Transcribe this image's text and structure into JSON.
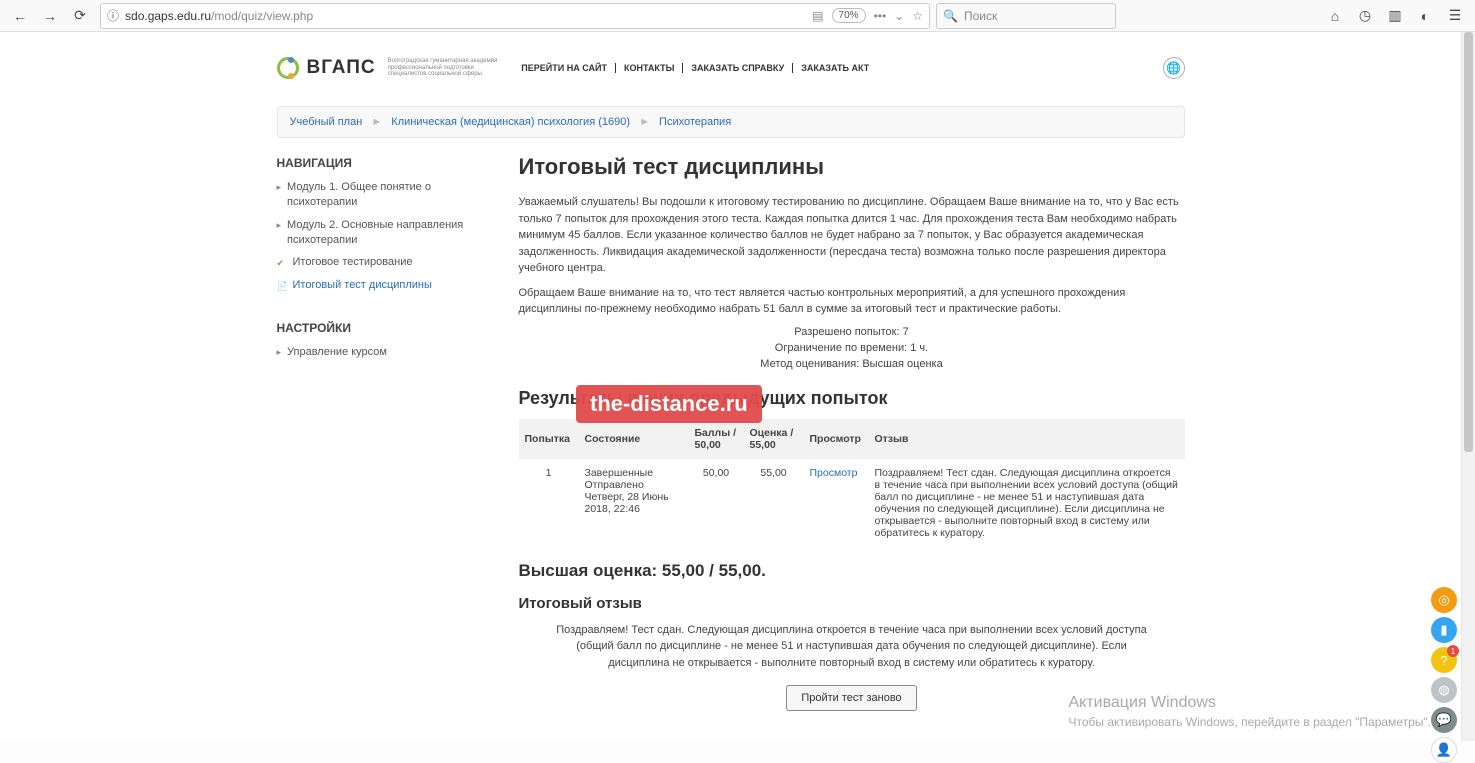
{
  "browser": {
    "url_domain": "sdo.gaps.edu.ru",
    "url_path": "/mod/quiz/view.php",
    "zoom": "70%",
    "search_placeholder": "Поиск"
  },
  "logo": {
    "text": "ВГАПС",
    "sub1": "Волгоградская гуманитарная академия",
    "sub2": "профессиональной подготовки",
    "sub3": "специалистов социальной сферы"
  },
  "top_links": [
    "ПЕРЕЙТИ НА САЙТ",
    "КОНТАКТЫ",
    "ЗАКАЗАТЬ СПРАВКУ",
    "ЗАКАЗАТЬ АКТ"
  ],
  "breadcrumbs": [
    "Учебный план",
    "Клиническая (медицинская) психология (1690)",
    "Психотерапия"
  ],
  "sidebar": {
    "nav_title": "НАВИГАЦИЯ",
    "items": [
      "Модуль 1. Общее понятие о психотерапии",
      "Модуль 2. Основные направления психотерапии",
      "Итоговое тестирование",
      "Итоговый тест дисциплины"
    ],
    "settings_title": "НАСТРОЙКИ",
    "settings_item": "Управление курсом"
  },
  "main": {
    "title": "Итоговый тест дисциплины",
    "intro1": "Уважаемый слушатель! Вы подошли к итоговому тестированию по дисциплине. Обращаем Ваше внимание на то, что у Вас есть только 7 попыток для прохождения этого теста.  Каждая попытка длится 1 час. Для прохождения теста Вам необходимо набрать минимум 45 баллов. Если указанное количество баллов не будет набрано за 7 попыток, у Вас образуется академическая задолженность. Ликвидация академической задолженности (пересдача теста) возможна только после разрешения директора учебного центра.",
    "intro2": "Обращаем Ваше внимание на то, что тест является частью контрольных мероприятий, а для успешного прохождения дисциплины по-прежнему необходимо набрать 51 балл в сумме за итоговый тест и практические работы.",
    "meta": {
      "allowed": "Разрешено попыток: 7",
      "timelimit": "Ограничение по времени: 1 ч.",
      "grading": "Метод оценивания: Высшая оценка"
    },
    "results_title": "Результаты ваших предыдущих попыток",
    "table": {
      "h_attempt": "Попытка",
      "h_state": "Состояние",
      "h_marks": "Баллы / 50,00",
      "h_grade": "Оценка / 55,00",
      "h_review": "Просмотр",
      "h_feedback": "Отзыв",
      "row": {
        "attempt": "1",
        "state_line1": "Завершенные",
        "state_line2": "Отправлено Четверг, 28 Июнь 2018, 22:46",
        "marks": "50,00",
        "grade": "55,00",
        "review": "Просмотр",
        "feedback": "Поздравляем! Тест сдан. Следующая дисциплина откроется в течение часа при выполнении всех условий доступа (общий балл по дисциплине - не менее 51 и наступившая дата обучения по следующей дисциплине). Если дисциплина не открывается - выполните повторный вход в систему или обратитесь к куратору."
      }
    },
    "highscore": "Высшая оценка: 55,00 / 55,00.",
    "feedback_h": "Итоговый отзыв",
    "overall": "Поздравляем! Тест сдан. Следующая дисциплина откроется в течение часа при выполнении всех условий доступа (общий балл по дисциплине - не менее 51 и наступившая дата обучения по следующей дисциплине). Если дисциплина не открывается - выполните повторный вход в систему или обратитесь к куратору.",
    "retry": "Пройти тест заново"
  },
  "watermark": "the-distance.ru",
  "activate": {
    "title": "Активация Windows",
    "body": "Чтобы активировать Windows, перейдите в раздел \"Параметры\"."
  },
  "badge": "1"
}
